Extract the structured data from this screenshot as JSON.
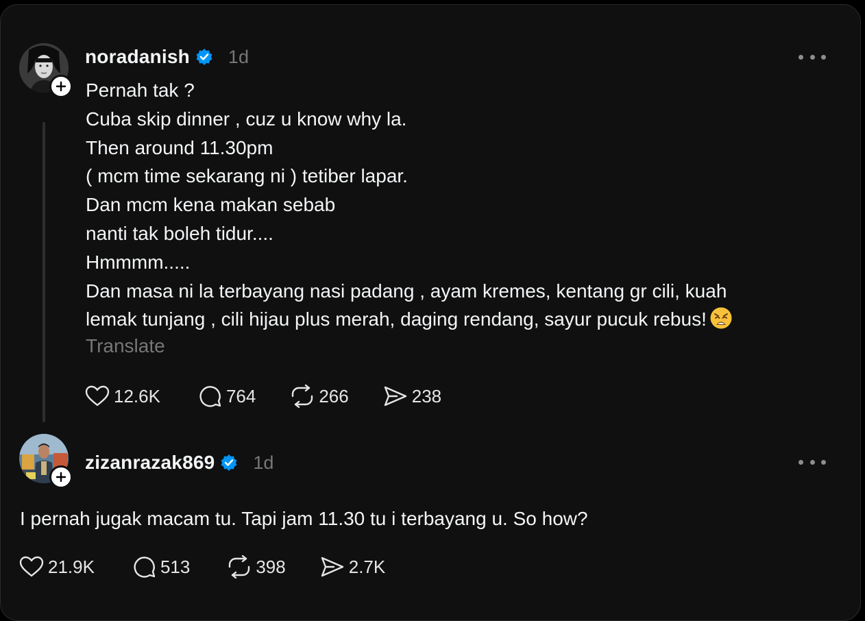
{
  "posts": [
    {
      "username": "noradanish",
      "time": "1d",
      "lines": [
        "Pernah tak ?",
        "Cuba skip dinner , cuz u know why la.",
        "Then around 11.30pm",
        "( mcm time sekarang ni ) tetiber lapar.",
        "Dan mcm kena makan sebab",
        "nanti tak boleh tidur....",
        "Hmmmm.....",
        "Dan masa ni la terbayang nasi padang , ayam kremes, kentang gr cili, kuah",
        "lemak tunjang , cili hijau plus merah, daging rendang, sayur pucuk rebus!"
      ],
      "emoji": "weary-face",
      "translate_label": "Translate",
      "likes": "12.6K",
      "comments": "764",
      "reposts": "266",
      "shares": "238"
    },
    {
      "username": "zizanrazak869",
      "time": "1d",
      "text": "I pernah jugak macam tu. Tapi jam 11.30 tu i terbayang u. So how?",
      "likes": "21.9K",
      "comments": "513",
      "reposts": "398",
      "shares": "2.7K"
    }
  ],
  "colors": {
    "background": "#101010",
    "text": "#f3f5f7",
    "muted": "#777777",
    "verified": "#0095f6"
  },
  "icons": [
    "heart-icon",
    "comment-icon",
    "repost-icon",
    "share-icon",
    "verified-badge-icon",
    "more-icon",
    "plus-icon"
  ]
}
